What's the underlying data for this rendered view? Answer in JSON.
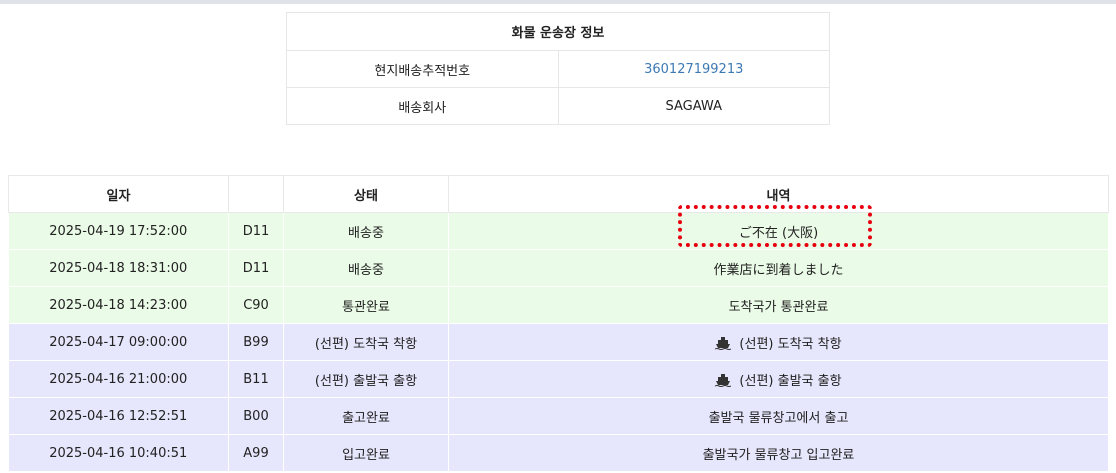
{
  "shipment_info": {
    "title": "화물 운송장 정보",
    "rows": [
      {
        "label": "현지배송추적번호",
        "value": "360127199213",
        "link": true
      },
      {
        "label": "배송회사",
        "value": "SAGAWA",
        "link": false
      }
    ]
  },
  "tracking": {
    "headers": {
      "date": "일자",
      "code": "",
      "status": "상태",
      "detail": "내역"
    },
    "rows": [
      {
        "date": "2025-04-19 17:52:00",
        "code": "D11",
        "status": "배송중",
        "detail": "ご不在 (大阪)",
        "group": "green",
        "icon": ""
      },
      {
        "date": "2025-04-18 18:31:00",
        "code": "D11",
        "status": "배송중",
        "detail": "作業店に到着しました",
        "group": "green",
        "icon": ""
      },
      {
        "date": "2025-04-18 14:23:00",
        "code": "C90",
        "status": "통관완료",
        "detail": "도착국가 통관완료",
        "group": "green",
        "icon": ""
      },
      {
        "date": "2025-04-17 09:00:00",
        "code": "B99",
        "status": "(선편) 도착국 착항",
        "detail": "(선편) 도착국 착항",
        "group": "purple",
        "icon": "ship-icon"
      },
      {
        "date": "2025-04-16 21:00:00",
        "code": "B11",
        "status": "(선편) 출발국 출항",
        "detail": "(선편) 출발국 출항",
        "group": "purple",
        "icon": "ship-icon"
      },
      {
        "date": "2025-04-16 12:52:51",
        "code": "B00",
        "status": "출고완료",
        "detail": "출발국 물류창고에서 출고",
        "group": "purple",
        "icon": ""
      },
      {
        "date": "2025-04-16 10:40:51",
        "code": "A99",
        "status": "입고완료",
        "detail": "출발국가 물류창고 입고완료",
        "group": "purple",
        "icon": ""
      }
    ]
  },
  "colors": {
    "link": "#3d79b5",
    "green_row": "#eafbe7",
    "purple_row": "#e6e6fc",
    "highlight": "#e8000f"
  }
}
